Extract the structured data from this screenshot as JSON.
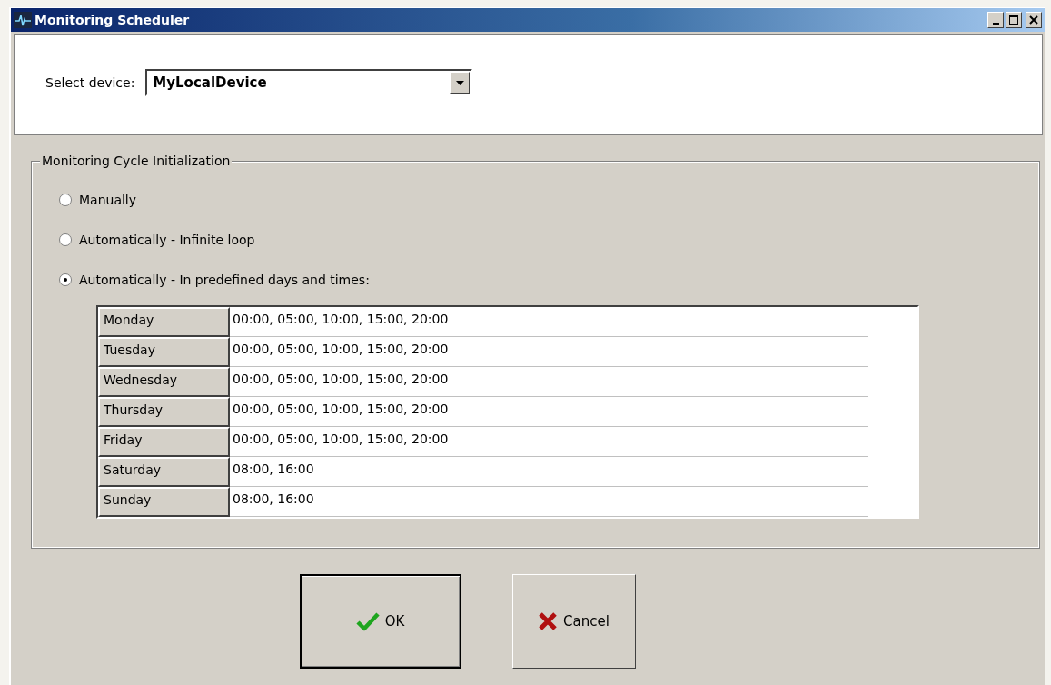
{
  "window": {
    "title": "Monitoring Scheduler"
  },
  "device": {
    "label": "Select device:",
    "value": "MyLocalDevice"
  },
  "group": {
    "title": "Monitoring Cycle Initialization"
  },
  "options": [
    {
      "label": "Manually",
      "selected": false
    },
    {
      "label": "Automatically - Infinite loop",
      "selected": false
    },
    {
      "label": "Automatically - In predefined days and times:",
      "selected": true
    }
  ],
  "schedule": [
    {
      "day": "Monday",
      "times": "00:00, 05:00, 10:00, 15:00, 20:00"
    },
    {
      "day": "Tuesday",
      "times": "00:00, 05:00, 10:00, 15:00, 20:00"
    },
    {
      "day": "Wednesday",
      "times": "00:00, 05:00, 10:00, 15:00, 20:00"
    },
    {
      "day": "Thursday",
      "times": "00:00, 05:00, 10:00, 15:00, 20:00"
    },
    {
      "day": "Friday",
      "times": "00:00, 05:00, 10:00, 15:00, 20:00"
    },
    {
      "day": "Saturday",
      "times": "08:00, 16:00"
    },
    {
      "day": "Sunday",
      "times": "08:00, 16:00"
    }
  ],
  "buttons": [
    {
      "kind": "ok",
      "label": "OK"
    },
    {
      "kind": "cancel",
      "label": "Cancel"
    }
  ]
}
